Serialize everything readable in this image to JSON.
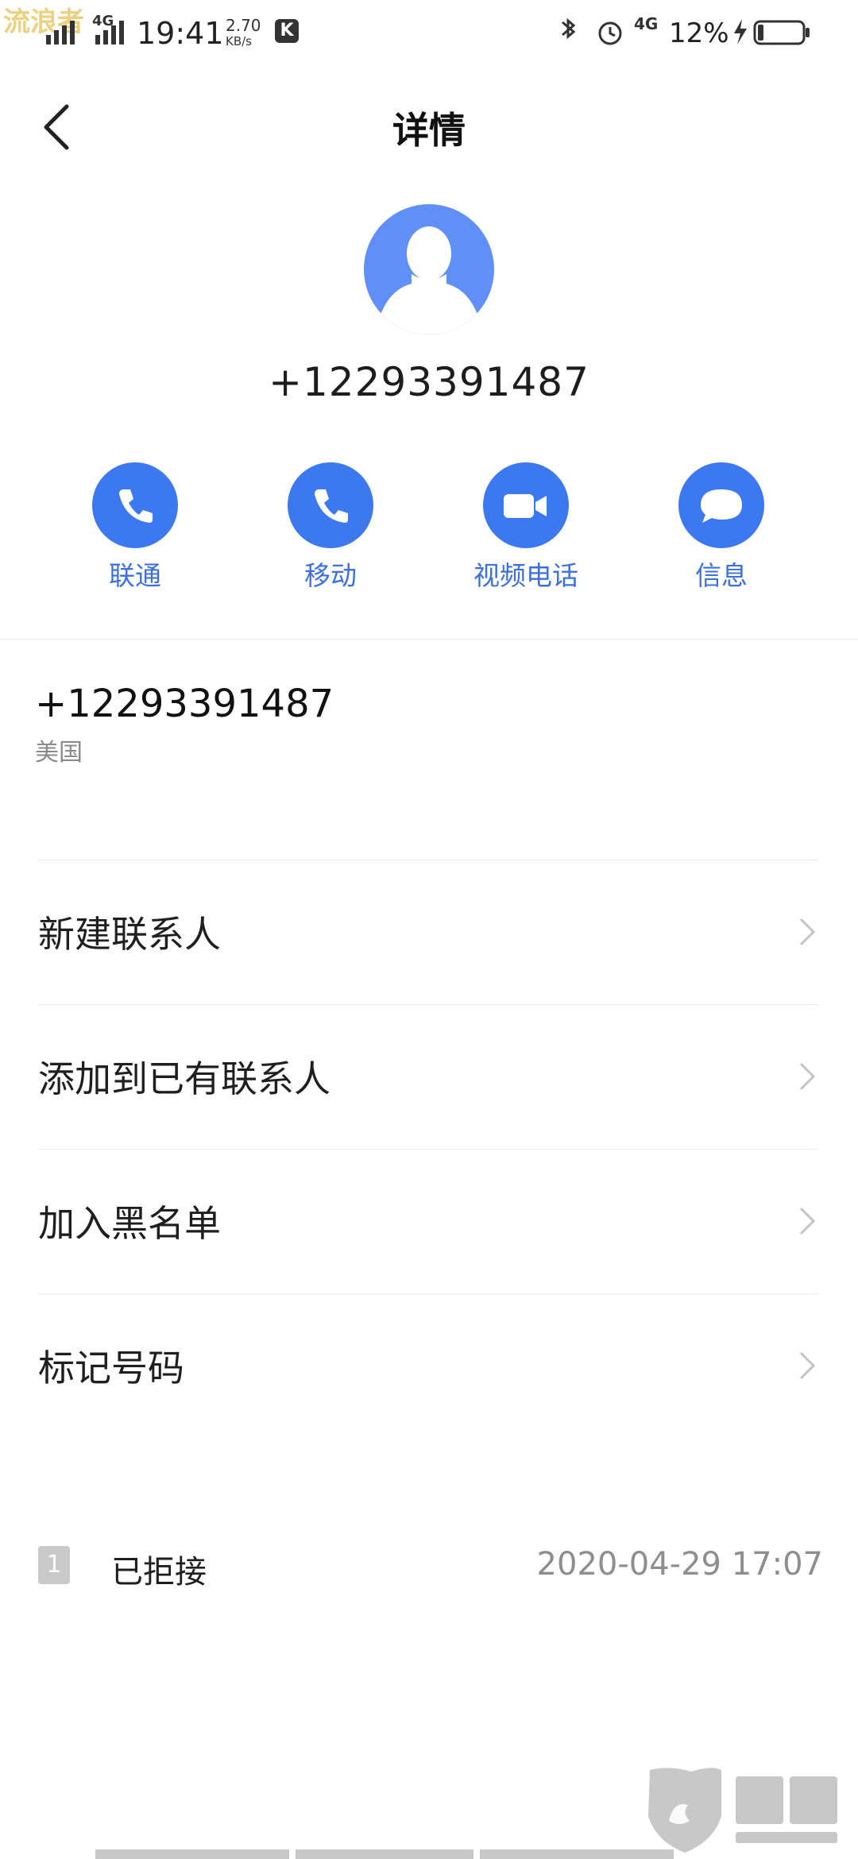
{
  "status_bar": {
    "watermark_top": "流浪者",
    "time": "19:41",
    "speed_value": "2.70",
    "speed_unit": "KB/s",
    "signal_label": "4G",
    "network_label": "4G",
    "battery": "12%",
    "icons": [
      "signal-icon",
      "bluetooth-icon",
      "vibrate-icon",
      "alarm-icon",
      "battery-icon",
      "charging-icon"
    ]
  },
  "header": {
    "title": "详情",
    "back_icon": "back-arrow-icon"
  },
  "contact": {
    "number": "+12293391487",
    "region": "美国"
  },
  "actions": [
    {
      "label": "联通",
      "icon": "phone-icon"
    },
    {
      "label": "移动",
      "icon": "phone-icon"
    },
    {
      "label": "视频电话",
      "icon": "video-icon"
    },
    {
      "label": "信息",
      "icon": "message-icon"
    }
  ],
  "menu": [
    {
      "label": "新建联系人"
    },
    {
      "label": "添加到已有联系人"
    },
    {
      "label": "加入黑名单"
    },
    {
      "label": "标记号码"
    }
  ],
  "call_log": {
    "sim_slot": "1",
    "status": "已拒接",
    "datetime": "2020-04-29 17:07"
  },
  "colors": {
    "accent": "#3c78f0",
    "avatar": "#5f8ff7",
    "label_blue": "#3c6fe0",
    "muted": "#8e8e8e"
  }
}
